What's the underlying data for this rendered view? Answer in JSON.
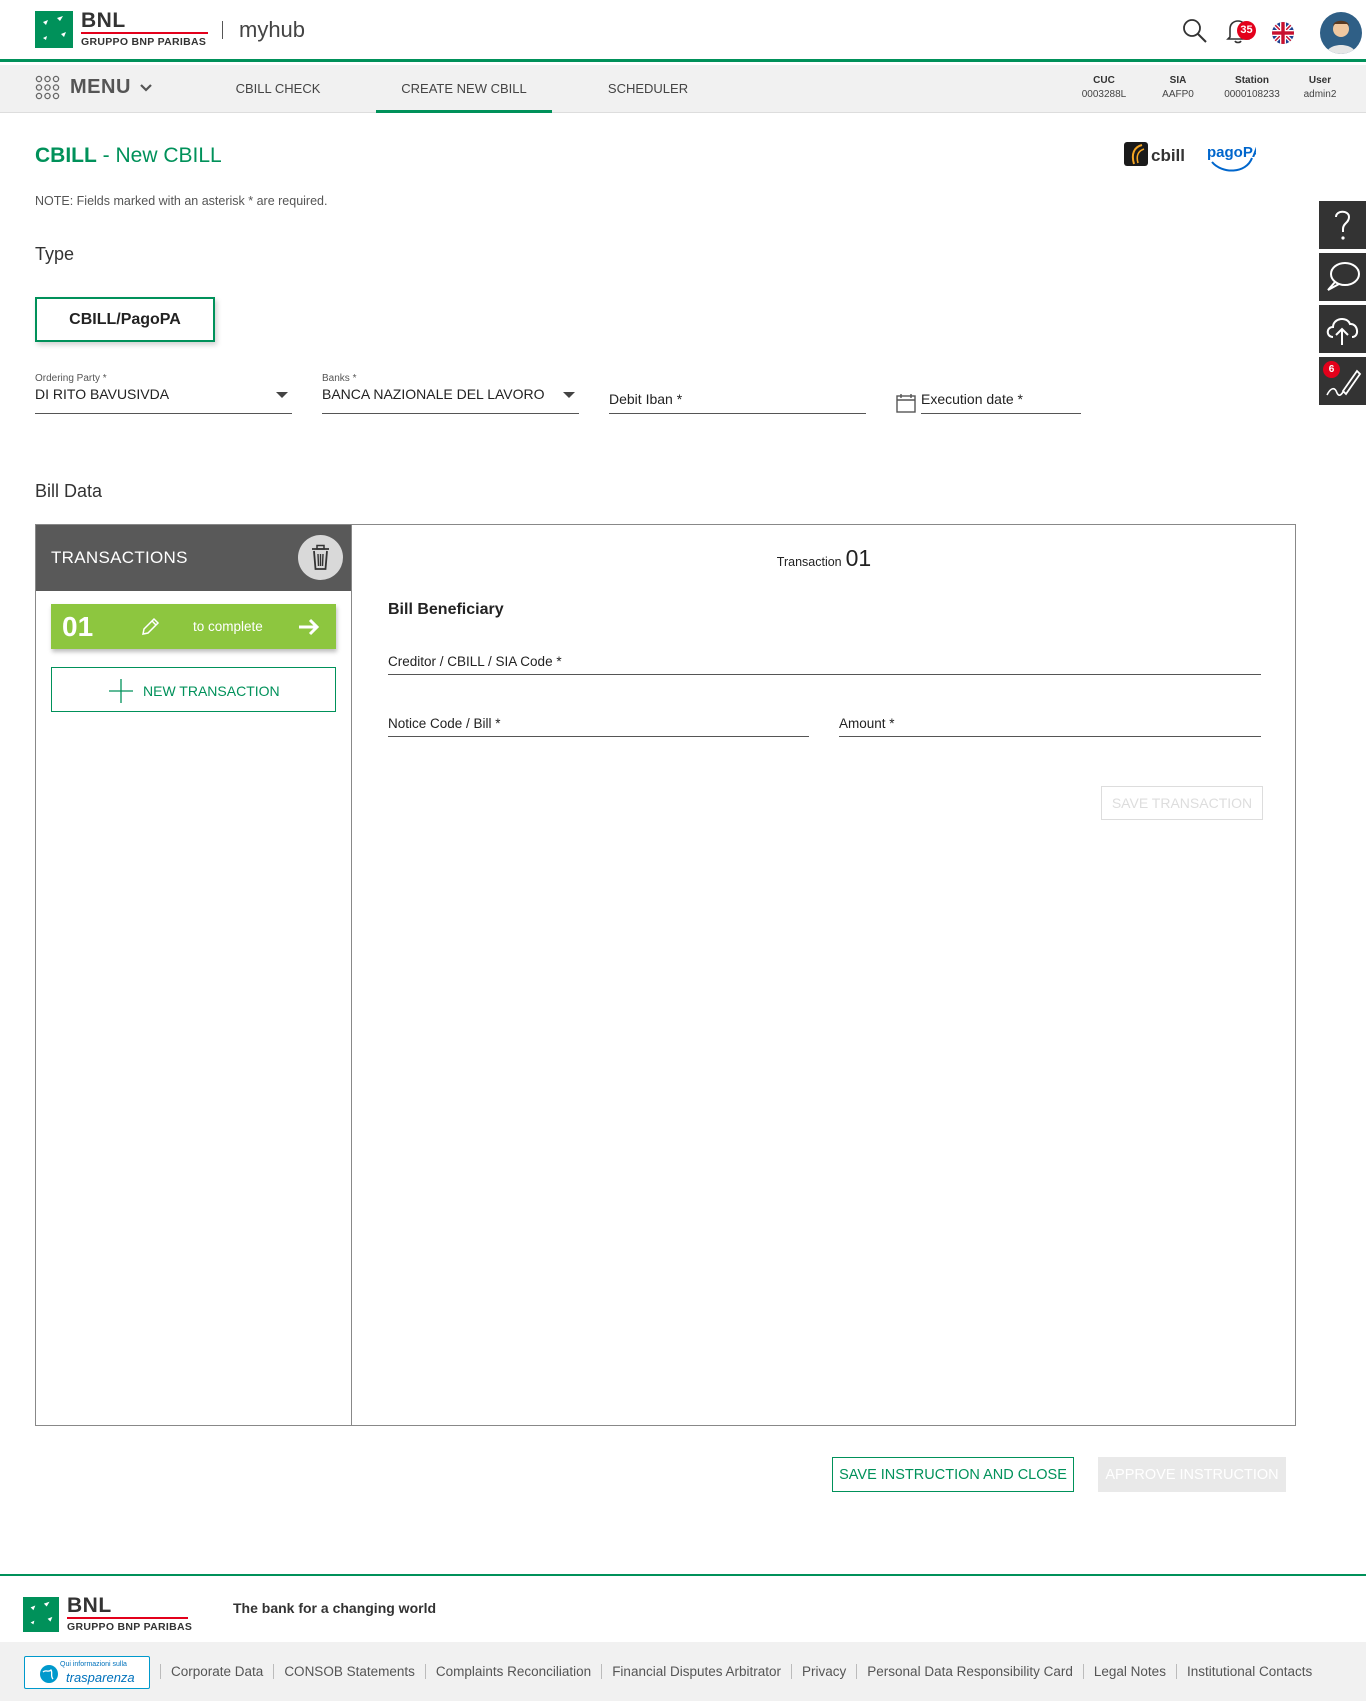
{
  "header": {
    "logo_brand": "BNL",
    "logo_group": "GRUPPO BNP PARIBAS",
    "app_name": "myhub",
    "notifications_count": "35",
    "icons": [
      "search-icon",
      "bell-icon",
      "uk-flag-icon",
      "user-avatar"
    ]
  },
  "nav": {
    "menu_label": "MENU",
    "tabs": [
      {
        "label": "CBILL CHECK",
        "active": false
      },
      {
        "label": "CREATE NEW CBILL",
        "active": true
      },
      {
        "label": "SCHEDULER",
        "active": false
      }
    ],
    "info": [
      {
        "key": "CUC",
        "value": "0003288L"
      },
      {
        "key": "SIA",
        "value": "AAFP0"
      },
      {
        "key": "Station",
        "value": "0000108233"
      },
      {
        "key": "User",
        "value": "admin2"
      }
    ]
  },
  "page": {
    "title_bold": "CBILL",
    "title_rest": " - New CBILL",
    "note": "NOTE: Fields marked with an asterisk * are required.",
    "logos": [
      "cbill",
      "pagoPA"
    ],
    "type_label": "Type",
    "type_button": "CBILL/PagoPA",
    "fields": {
      "ordering_party_label": "Ordering Party *",
      "ordering_party_value": "DI RITO BAVUSIVDA",
      "banks_label": "Banks *",
      "banks_value": "BANCA NAZIONALE DEL LAVORO",
      "debit_iban_placeholder": "Debit Iban *",
      "execution_date_placeholder": "Execution date *"
    },
    "bill_data_label": "Bill Data"
  },
  "transactions": {
    "header": "TRANSACTIONS",
    "items": [
      {
        "number": "01",
        "status": "to complete"
      }
    ],
    "new_button": "NEW TRANSACTION"
  },
  "detail": {
    "title_small": "Transaction",
    "title_number": "01",
    "section": "Bill Beneficiary",
    "creditor_placeholder": "Creditor / CBILL / SIA Code *",
    "notice_placeholder": "Notice Code / Bill *",
    "amount_placeholder": "Amount *",
    "save_button": "SAVE TRANSACTION"
  },
  "actions": {
    "save_close": "SAVE INSTRUCTION AND CLOSE",
    "approve": "APPROVE INSTRUCTION"
  },
  "side_tools": {
    "items": [
      "help-icon",
      "chat-icon",
      "upload-cloud-icon",
      "signature-icon"
    ],
    "signature_badge": "6"
  },
  "footer": {
    "logo_brand": "BNL",
    "logo_group": "GRUPPO BNP PARIBAS",
    "tagline": "The bank for a changing world",
    "transparency_small": "Qui informazioni sulla",
    "transparency_big": "trasparenza",
    "links": [
      "Corporate Data",
      "CONSOB Statements",
      "Complaints Reconciliation",
      "Financial Disputes Arbitrator",
      "Privacy",
      "Personal Data Responsibility Card",
      "Legal Notes",
      "Institutional Contacts"
    ]
  },
  "colors": {
    "brand_green": "#00915a",
    "transaction_green": "#8dc63f",
    "badge_red": "#e3001b",
    "dark_panel": "#595959"
  }
}
